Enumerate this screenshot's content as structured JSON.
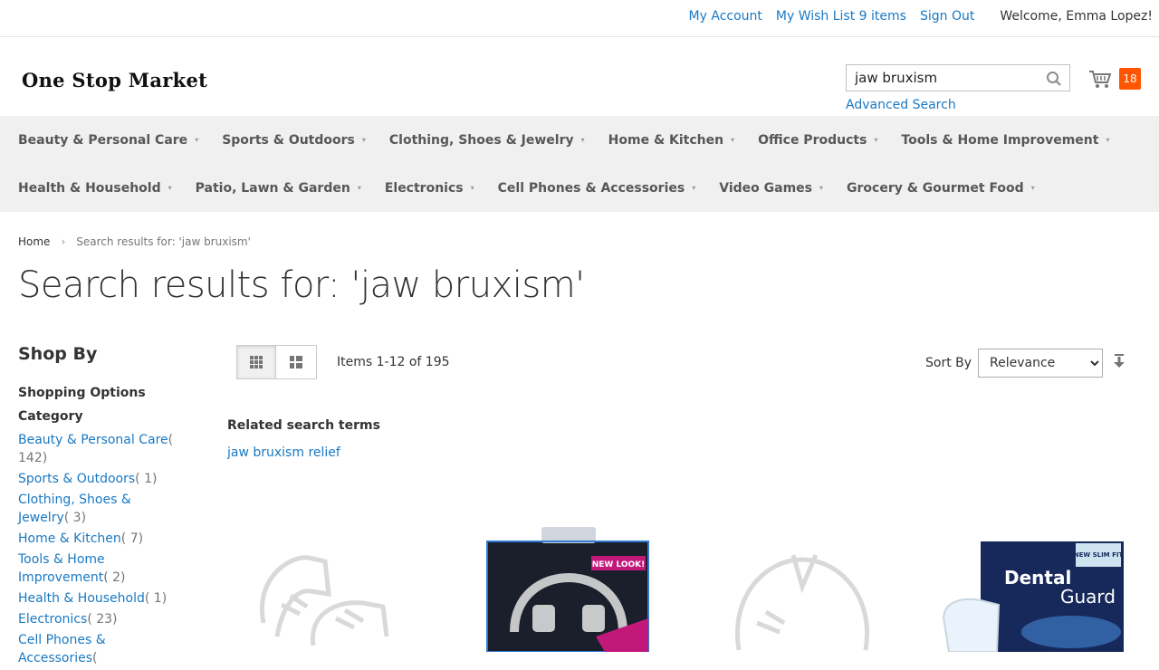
{
  "header": {
    "links": [
      "My Account",
      "My Wish List 9 items",
      "Sign Out"
    ],
    "welcome": "Welcome, Emma Lopez!",
    "logo": "One Stop Market",
    "search_value": "jaw bruxism",
    "advanced_search": "Advanced Search",
    "cart_count": "18"
  },
  "nav": {
    "row1": [
      "Beauty & Personal Care",
      "Sports & Outdoors",
      "Clothing, Shoes & Jewelry",
      "Home & Kitchen",
      "Office Products",
      "Tools & Home Improvement"
    ],
    "row2": [
      "Health & Household",
      "Patio, Lawn & Garden",
      "Electronics",
      "Cell Phones & Accessories",
      "Video Games",
      "Grocery & Gourmet Food"
    ]
  },
  "breadcrumb": {
    "home": "Home",
    "current": "Search results for: 'jaw bruxism'"
  },
  "page_title": "Search results for: 'jaw bruxism'",
  "sidebar": {
    "shop_by": "Shop By",
    "shopping_options": "Shopping Options",
    "category_title": "Category",
    "categories": [
      {
        "name": "Beauty & Personal Care",
        "count": "( 142)"
      },
      {
        "name": "Sports & Outdoors",
        "count": "( 1)"
      },
      {
        "name": "Clothing, Shoes & Jewelry",
        "count": "( 3)"
      },
      {
        "name": "Home & Kitchen",
        "count": "( 7)"
      },
      {
        "name": "Tools & Home Improvement",
        "count": "( 2)"
      },
      {
        "name": "Health & Household",
        "count": "( 1)"
      },
      {
        "name": "Electronics",
        "count": "( 23)"
      },
      {
        "name": "Cell Phones & Accessories",
        "count": "("
      }
    ]
  },
  "toolbar": {
    "amount": "Items 1-12 of 195",
    "sort_label": "Sort By",
    "sort_value": "Relevance"
  },
  "related": {
    "title": "Related search terms",
    "link": "jaw bruxism relief"
  },
  "products": [
    {
      "icon": "clear-mouth-guard-image"
    },
    {
      "icon": "boxed-mouth-guard-image",
      "badge": "NEW LOOK!"
    },
    {
      "icon": "clear-mouth-guard-image"
    },
    {
      "icon": "dental-guard-box-image",
      "brand": "Dental",
      "brand2": "Guard",
      "badge": "NEW SLIM FIT"
    }
  ]
}
